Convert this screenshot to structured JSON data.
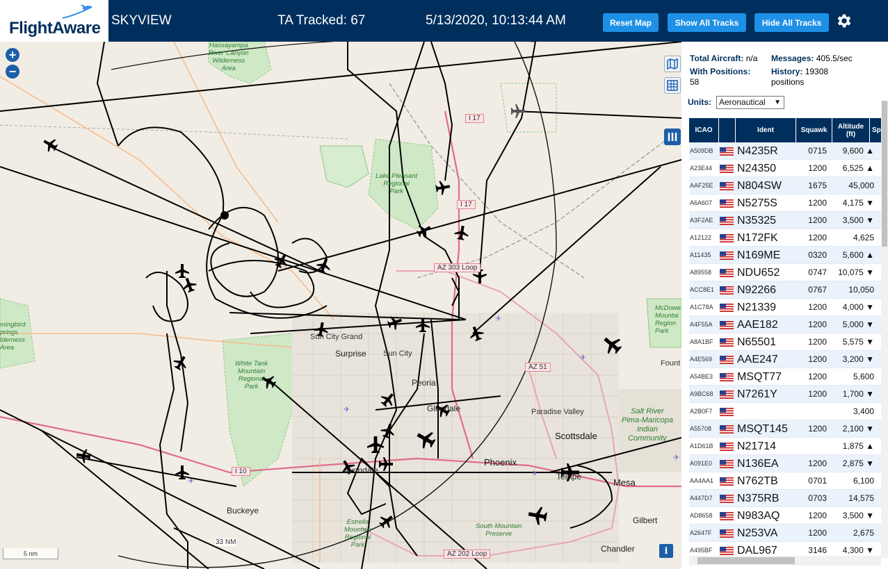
{
  "header": {
    "logo_main": "FlightAware",
    "app_title": "SKYVIEW",
    "tracked": "TA Tracked: 67",
    "datetime": "5/13/2020, 10:13:44 AM",
    "buttons": {
      "reset": "Reset Map",
      "show_all": "Show All Tracks",
      "hide_all": "Hide All Tracks"
    }
  },
  "map": {
    "zoom_in": "+",
    "zoom_out": "−",
    "scale": "5 nm",
    "range_ring": "33 NM",
    "info": "i",
    "parks": {
      "hassayampa": "Hassayampa\nRiver Canyon\nWilderness\nArea",
      "pleasant": "Lake Pleasant\nRegional\nPark",
      "white_tank": "White Tank\nMountain\nRegional\nPark",
      "estrella": "Estrella\nMountain\nRegional\nPark",
      "south_mountain": "South Mountain\nPreserve",
      "mcdowell": "McDowe\nMountai\nRegion\nPark",
      "hummingbird": "mingbird\nprings\nlderness\nArea",
      "salt_river": "Salt River\nPima-Maricopa\nIndian\nCommunity"
    },
    "cities": {
      "sun_city_grand": "Sun City Grand",
      "surprise": "Surprise",
      "sun_city": "Sun City",
      "peoria": "Peoria",
      "glendale": "Glendale",
      "paradise_valley": "Paradise Valley",
      "scottsdale": "Scottsdale",
      "phoenix": "Phoenix",
      "tempe": "Tempe",
      "mesa": "Mesa",
      "avondale": "Avondale",
      "buckeye": "Buckeye",
      "gilbert": "Gilbert",
      "chandler": "Chandler",
      "fountain": "Fount"
    },
    "shields": {
      "i17a": "I 17",
      "i17b": "I 17",
      "az303": "AZ 303 Loop",
      "az51": "AZ 51",
      "i10": "I 10",
      "az202": "AZ 202 Loop"
    }
  },
  "panel": {
    "total_aircraft_label": "Total Aircraft:",
    "total_aircraft_value": "n/a",
    "messages_label": "Messages:",
    "messages_value": "405.5/sec",
    "with_positions_label": "With Positions:",
    "with_positions_value": "58",
    "history_label": "History:",
    "history_value": "19308",
    "history_unit": "positions",
    "units_label": "Units:",
    "units_value": "Aeronautical",
    "columns": {
      "icao": "ICAO",
      "ident": "Ident",
      "squawk": "Squawk",
      "altitude": "Altitude\n(ft)",
      "speed": "Sp"
    },
    "rows": [
      {
        "icao": "A509DB",
        "ident": "N4235R",
        "squawk": "0715",
        "alt": "9,600 ▲"
      },
      {
        "icao": "A23E44",
        "ident": "N24350",
        "squawk": "1200",
        "alt": "6,525 ▲"
      },
      {
        "icao": "AAF25E",
        "ident": "N804SW",
        "squawk": "1675",
        "alt": "45,000"
      },
      {
        "icao": "A6A607",
        "ident": "N5275S",
        "squawk": "1200",
        "alt": "4,175 ▼"
      },
      {
        "icao": "A3F2AE",
        "ident": "N35325",
        "squawk": "1200",
        "alt": "3,500 ▼"
      },
      {
        "icao": "A12122",
        "ident": "N172FK",
        "squawk": "1200",
        "alt": "4,625"
      },
      {
        "icao": "A11435",
        "ident": "N169ME",
        "squawk": "0320",
        "alt": "5,600 ▲"
      },
      {
        "icao": "A89558",
        "ident": "NDU652",
        "squawk": "0747",
        "alt": "10,075 ▼"
      },
      {
        "icao": "ACC8E1",
        "ident": "N92266",
        "squawk": "0767",
        "alt": "10,050"
      },
      {
        "icao": "A1C78A",
        "ident": "N21339",
        "squawk": "1200",
        "alt": "4,000 ▼"
      },
      {
        "icao": "A4F55A",
        "ident": "AAE182",
        "squawk": "1200",
        "alt": "5,000 ▼"
      },
      {
        "icao": "A8A1BF",
        "ident": "N65501",
        "squawk": "1200",
        "alt": "5,575 ▼"
      },
      {
        "icao": "A4E569",
        "ident": "AAE247",
        "squawk": "1200",
        "alt": "3,200 ▼"
      },
      {
        "icao": "A54BE3",
        "ident": "MSQT77",
        "squawk": "1200",
        "alt": "5,600"
      },
      {
        "icao": "A9BC68",
        "ident": "N7261Y",
        "squawk": "1200",
        "alt": "1,700 ▼"
      },
      {
        "icao": "A2B0F7",
        "ident": "",
        "squawk": "",
        "alt": "3,400"
      },
      {
        "icao": "A55708",
        "ident": "MSQT145",
        "squawk": "1200",
        "alt": "2,100 ▼"
      },
      {
        "icao": "A1D61B",
        "ident": "N21714",
        "squawk": "",
        "alt": "1,875 ▲"
      },
      {
        "icao": "A091E0",
        "ident": "N136EA",
        "squawk": "1200",
        "alt": "2,875 ▼"
      },
      {
        "icao": "AA4AA1",
        "ident": "N762TB",
        "squawk": "0701",
        "alt": "6,100"
      },
      {
        "icao": "A447D7",
        "ident": "N375RB",
        "squawk": "0703",
        "alt": "14,575"
      },
      {
        "icao": "AD8658",
        "ident": "N983AQ",
        "squawk": "1200",
        "alt": "3,500 ▼"
      },
      {
        "icao": "A2647F",
        "ident": "N253VA",
        "squawk": "1200",
        "alt": "2,675"
      },
      {
        "icao": "A495BF",
        "ident": "DAL967",
        "squawk": "3146",
        "alt": "4,300 ▼"
      }
    ]
  }
}
